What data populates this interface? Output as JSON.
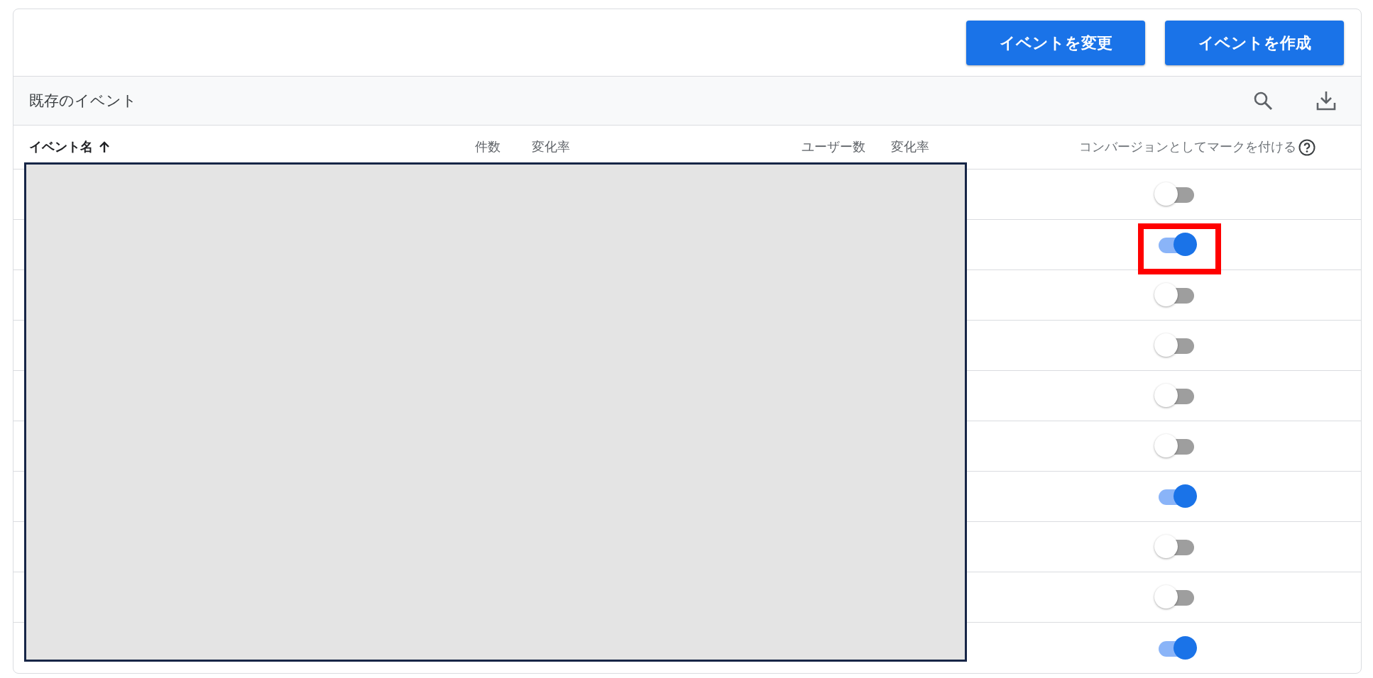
{
  "toolbar": {
    "buttons": [
      "イベントを変更",
      "イベントを作成"
    ]
  },
  "section": {
    "title": "既存のイベント"
  },
  "table": {
    "columns": [
      {
        "label": "イベント名",
        "sorted_ascending": true
      },
      {
        "label": "件数"
      },
      {
        "label": "変化率"
      },
      {
        "label": "ユーザー数"
      },
      {
        "label": "変化率"
      },
      {
        "label": "コンバージョンとしてマークを付ける",
        "help": true
      }
    ],
    "redacted": true,
    "rows": [
      {
        "conversion": false,
        "highlighted": false
      },
      {
        "conversion": true,
        "highlighted": true
      },
      {
        "conversion": false,
        "highlighted": false
      },
      {
        "conversion": false,
        "highlighted": false
      },
      {
        "conversion": false,
        "highlighted": false
      },
      {
        "conversion": false,
        "highlighted": false
      },
      {
        "conversion": true,
        "highlighted": false
      },
      {
        "conversion": false,
        "highlighted": false
      },
      {
        "conversion": false,
        "highlighted": false
      },
      {
        "conversion": true,
        "highlighted": false
      }
    ]
  }
}
